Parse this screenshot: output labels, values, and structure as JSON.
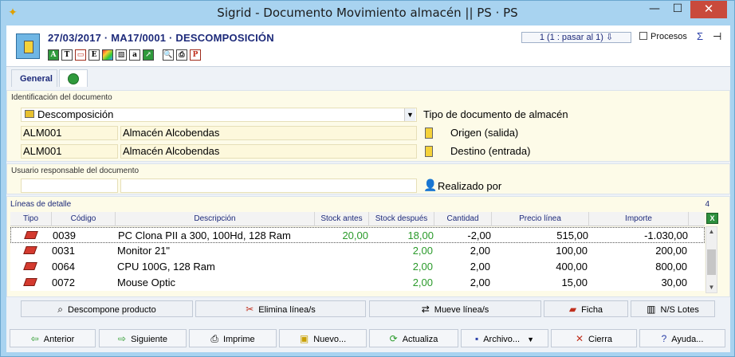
{
  "window": {
    "title": "Sigrid - Documento Movimiento almacén || PS · PS",
    "minimize": "—",
    "maximize": "☐",
    "close": "✕"
  },
  "header": {
    "doc_title": "27/03/2017 · MA17/0001 · DESCOMPOSICIÓN",
    "pager": "1 (1 : pasar al 1)",
    "procesos": "Procesos"
  },
  "tabs": [
    {
      "label": "General"
    }
  ],
  "id_panel": {
    "label": "Identificación del documento",
    "doc_type_value": "Descomposición",
    "doc_type_label": "Tipo de documento de almacén",
    "origin_code": "ALM001",
    "origin_name": "Almacén Alcobendas",
    "origin_label": "Origen (salida)",
    "dest_code": "ALM001",
    "dest_name": "Almacén Alcobendas",
    "dest_label": "Destino (entrada)"
  },
  "user_panel": {
    "label": "Usuario responsable del documento",
    "realizado": "Realizado por"
  },
  "lines": {
    "label": "Líneas de detalle",
    "count": "4",
    "columns": [
      "Tipo",
      "Código",
      "Descripción",
      "Stock antes",
      "Stock después",
      "Cantidad",
      "Precio línea",
      "Importe"
    ],
    "rows": [
      {
        "codigo": "0039",
        "desc": "PC Clona PII a 300, 100Hd, 128 Ram",
        "antes": "20,00",
        "despues": "18,00",
        "cantidad": "-2,00",
        "precio": "515,00",
        "importe": "-1.030,00"
      },
      {
        "codigo": "0031",
        "desc": "Monitor 21\"",
        "antes": "",
        "despues": "2,00",
        "cantidad": "2,00",
        "precio": "100,00",
        "importe": "200,00"
      },
      {
        "codigo": "0064",
        "desc": "CPU 100G, 128 Ram",
        "antes": "",
        "despues": "2,00",
        "cantidad": "2,00",
        "precio": "400,00",
        "importe": "800,00"
      },
      {
        "codigo": "0072",
        "desc": "Mouse Optic",
        "antes": "",
        "despues": "2,00",
        "cantidad": "2,00",
        "precio": "15,00",
        "importe": "30,00"
      }
    ]
  },
  "actions": {
    "descompone": "Descompone producto",
    "elimina": "Elimina línea/s",
    "mueve": "Mueve línea/s",
    "ficha": "Ficha",
    "ns_lotes": "N/S Lotes"
  },
  "nav": {
    "anterior": "Anterior",
    "siguiente": "Siguiente",
    "imprime": "Imprime",
    "nuevo": "Nuevo...",
    "actualiza": "Actualiza",
    "archivo": "Archivo...",
    "cierra": "Cierra",
    "ayuda": "Ayuda..."
  },
  "colors": {
    "titlebar": "#a8d3f0",
    "close": "#c94a3c",
    "panel": "#fdfbe8",
    "accent_text": "#1d2a7a",
    "stock_green": "#2a9a2a"
  }
}
